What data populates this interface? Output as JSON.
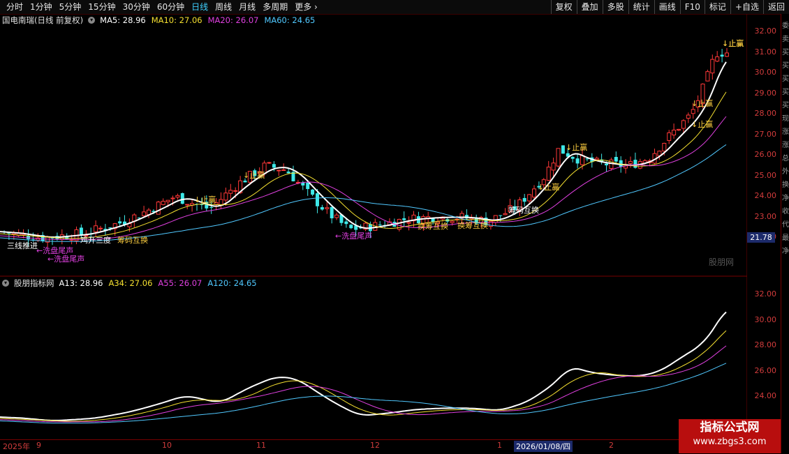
{
  "toolbar": {
    "timeframes": [
      "分时",
      "1分钟",
      "5分钟",
      "15分钟",
      "30分钟",
      "60分钟",
      "日线",
      "周线",
      "月线",
      "多周期",
      "更多"
    ],
    "active": "日线",
    "right_buttons": [
      "复权",
      "叠加",
      "多股",
      "统计",
      "画线",
      "F10",
      "标记",
      "+自选",
      "返回"
    ]
  },
  "main_chart": {
    "title": "国电南瑞(日线 前复权)",
    "ma": [
      {
        "label": "MA5: 28.96",
        "color": "#ffffff"
      },
      {
        "label": "MA10: 27.06",
        "color": "#f5e030"
      },
      {
        "label": "MA20: 26.07",
        "color": "#e040e0"
      },
      {
        "label": "MA60: 24.65",
        "color": "#50c8ff"
      }
    ],
    "y_ticks": [
      "32.00",
      "31.00",
      "30.00",
      "29.00",
      "28.00",
      "27.00",
      "26.00",
      "25.00",
      "24.00",
      "23.00",
      "22.00"
    ],
    "current_price": "21.78",
    "watermark": "股朋网",
    "annotations": [
      "三线推进",
      "←洗盘尾声",
      "←洗盘尾声",
      "鸡开三度",
      "筹码互换",
      "↓止赢",
      "↓止赢",
      "←洗盘尾声",
      "换筹互换",
      "换筹互换",
      "↓止赢",
      "↓止赢",
      "筹码互换",
      "↓止赢",
      "↓止赢",
      "↓止赢",
      "↓止赢"
    ]
  },
  "sub_chart": {
    "title": "股朋指标网",
    "ma": [
      {
        "label": "A13: 28.96",
        "color": "#ffffff"
      },
      {
        "label": "A34: 27.06",
        "color": "#f5e030"
      },
      {
        "label": "A55: 26.07",
        "color": "#e040e0"
      },
      {
        "label": "A120: 24.65",
        "color": "#50c8ff"
      }
    ],
    "y_ticks": [
      "32.00",
      "30.00",
      "28.00",
      "26.00",
      "24.00"
    ]
  },
  "dates": {
    "labels": [
      "2025年",
      "9",
      "10",
      "11",
      "12",
      "1",
      "2"
    ],
    "selected": "2026/01/08/四"
  },
  "sidebar_text": [
    "委",
    "卖",
    "买",
    "买",
    "买",
    "买",
    "买",
    "现",
    "涨",
    "涨",
    "总",
    "外",
    "换",
    "净",
    "收",
    "代",
    "最",
    "净"
  ],
  "watermark_site": {
    "name": "指标公式网",
    "url": "www.zbgs3.com"
  }
}
